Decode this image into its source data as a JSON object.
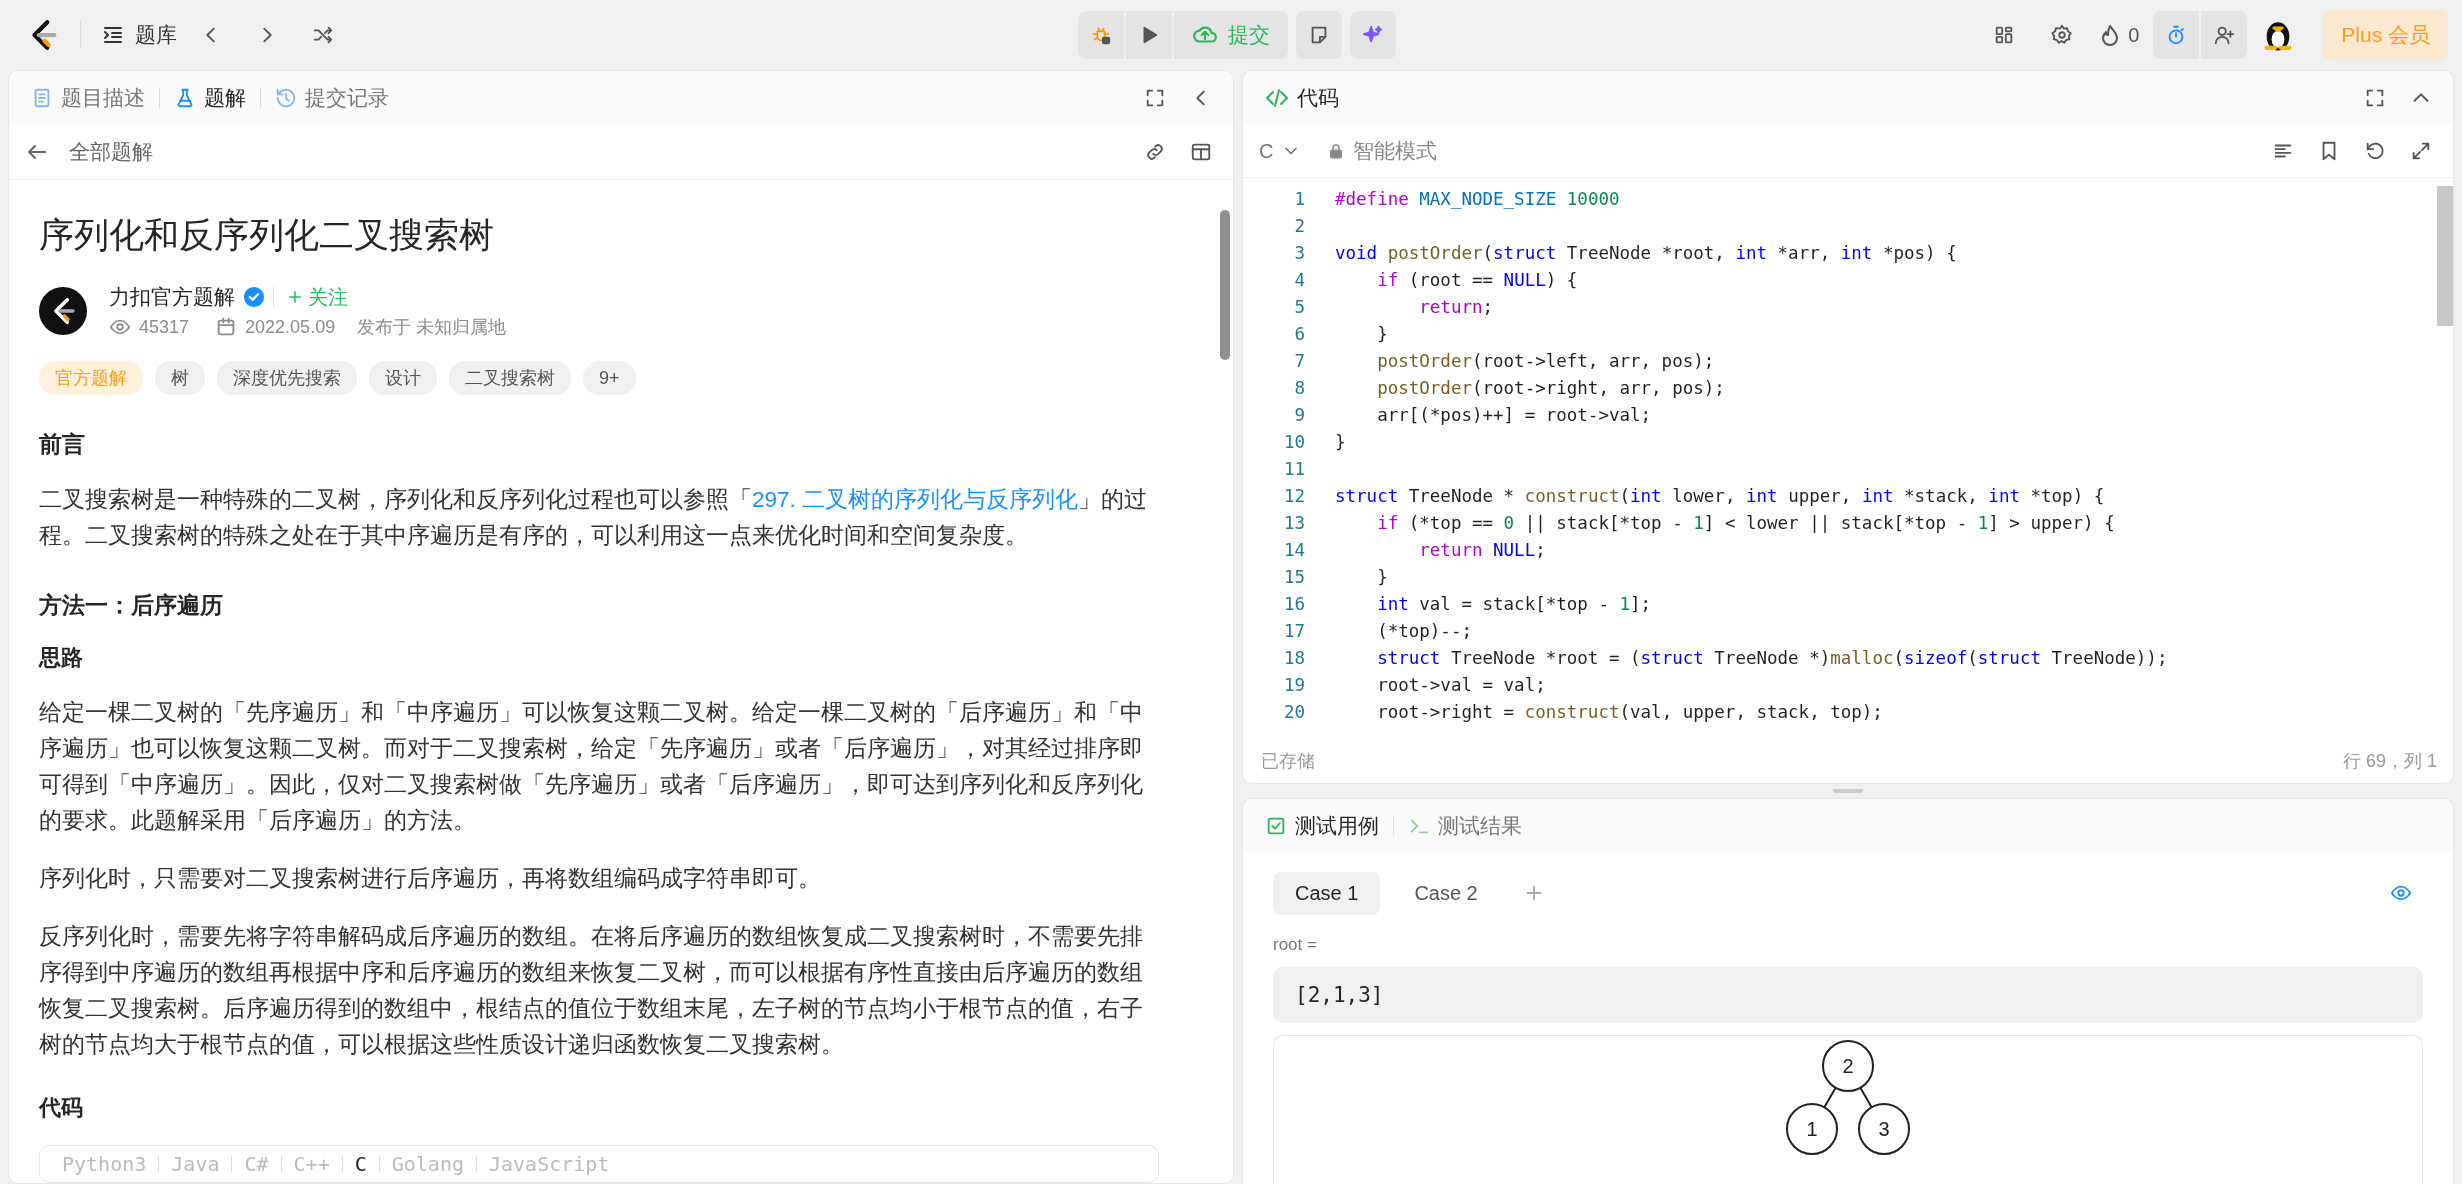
{
  "topbar": {
    "problem_list": "题库",
    "submit": "提交",
    "streak": "0",
    "plus": "Plus 会员"
  },
  "left_panel": {
    "tabs": [
      {
        "label": "题目描述",
        "selected": false
      },
      {
        "label": "题解",
        "selected": true
      },
      {
        "label": "提交记录",
        "selected": false
      }
    ],
    "back_link": "全部题解",
    "article": {
      "title": "序列化和反序列化二叉搜索树",
      "author": "力扣官方题解",
      "verified": true,
      "follow": "关注",
      "views": "45317",
      "date": "2022.05.09",
      "location": "发布于 未知归属地",
      "tags": [
        {
          "label": "官方题解",
          "kind": "official"
        },
        {
          "label": "树",
          "kind": "topic"
        },
        {
          "label": "深度优先搜索",
          "kind": "topic"
        },
        {
          "label": "设计",
          "kind": "topic"
        },
        {
          "label": "二叉搜索树",
          "kind": "topic"
        },
        {
          "label": "9+",
          "kind": "topic"
        }
      ],
      "blocks": [
        {
          "kind": "h2",
          "text": "前言"
        },
        {
          "kind": "p",
          "before": "二叉搜索树是一种特殊的二叉树，序列化和反序列化过程也可以参照「",
          "link": "297. 二叉树的序列化与反序列化",
          "after": "」的过程。二叉搜索树的特殊之处在于其中序遍历是有序的，可以利用这一点来优化时间和空间复杂度。"
        },
        {
          "kind": "h2",
          "text": "方法一：后序遍历"
        },
        {
          "kind": "h3",
          "text": "思路"
        },
        {
          "kind": "p",
          "before": "给定一棵二叉树的「先序遍历」和「中序遍历」可以恢复这颗二叉树。给定一棵二叉树的「后序遍历」和「中序遍历」也可以恢复这颗二叉树。而对于二叉搜索树，给定「先序遍历」或者「后序遍历」，对其经过排序即可得到「中序遍历」。因此，仅对二叉搜索树做「先序遍历」或者「后序遍历」，即可达到序列化和反序列化的要求。此题解采用「后序遍历」的方法。"
        },
        {
          "kind": "p",
          "before": "序列化时，只需要对二叉搜索树进行后序遍历，再将数组编码成字符串即可。"
        },
        {
          "kind": "p",
          "before": "反序列化时，需要先将字符串解码成后序遍历的数组。在将后序遍历的数组恢复成二叉搜索树时，不需要先排序得到中序遍历的数组再根据中序和后序遍历的数组来恢复二叉树，而可以根据有序性直接由后序遍历的数组恢复二叉搜索树。后序遍历得到的数组中，根结点的值位于数组末尾，左子树的节点均小于根节点的值，右子树的节点均大于根节点的值，可以根据这些性质设计递归函数恢复二叉搜索树。"
        },
        {
          "kind": "h3",
          "text": "代码"
        }
      ],
      "code_tabs": [
        {
          "label": "Python3",
          "selected": false
        },
        {
          "label": "Java",
          "selected": false
        },
        {
          "label": "C#",
          "selected": false
        },
        {
          "label": "C++",
          "selected": false
        },
        {
          "label": "C",
          "selected": true
        },
        {
          "label": "Golang",
          "selected": false
        },
        {
          "label": "JavaScript",
          "selected": false
        }
      ]
    }
  },
  "editor": {
    "title": "代码",
    "language": "C",
    "mode": "智能模式",
    "status": "已存储",
    "cursor": "行 69，列 1",
    "lines": [
      {
        "number": "1",
        "tokens": [
          {
            "kind": "keyword",
            "text": "#define "
          },
          {
            "kind": "macro",
            "text": "MAX_NODE_SIZE "
          },
          {
            "kind": "number",
            "text": "10000"
          }
        ]
      },
      {
        "number": "2"
      },
      {
        "number": "3",
        "tokens": [
          {
            "kind": "type",
            "text": "void "
          },
          {
            "kind": "function",
            "text": "postOrder"
          },
          {
            "kind": "plain",
            "text": "("
          },
          {
            "kind": "type",
            "text": "struct "
          },
          {
            "kind": "plain",
            "text": "TreeNode *root, "
          },
          {
            "kind": "type",
            "text": "int "
          },
          {
            "kind": "plain",
            "text": "*arr, "
          },
          {
            "kind": "type",
            "text": "int "
          },
          {
            "kind": "plain",
            "text": "*pos) {"
          }
        ]
      },
      {
        "number": "4",
        "tokens": [
          {
            "kind": "keyword",
            "text": "    if "
          },
          {
            "kind": "plain",
            "text": "(root == "
          },
          {
            "kind": "type",
            "text": "NULL"
          },
          {
            "kind": "plain",
            "text": ") {"
          }
        ]
      },
      {
        "number": "5",
        "tokens": [
          {
            "kind": "keyword",
            "text": "        return"
          },
          {
            "kind": "plain",
            "text": ";"
          }
        ]
      },
      {
        "number": "6",
        "tokens": [
          {
            "kind": "plain",
            "text": "    }"
          }
        ]
      },
      {
        "number": "7",
        "tokens": [
          {
            "kind": "function",
            "text": "    postOrder"
          },
          {
            "kind": "plain",
            "text": "(root->left, arr, pos);"
          }
        ]
      },
      {
        "number": "8",
        "tokens": [
          {
            "kind": "function",
            "text": "    postOrder"
          },
          {
            "kind": "plain",
            "text": "(root->right, arr, pos);"
          }
        ]
      },
      {
        "number": "9",
        "tokens": [
          {
            "kind": "plain",
            "text": "    arr[(*pos)++] = root->val;"
          }
        ]
      },
      {
        "number": "10",
        "tokens": [
          {
            "kind": "plain",
            "text": "}"
          }
        ]
      },
      {
        "number": "11"
      },
      {
        "number": "12",
        "tokens": [
          {
            "kind": "type",
            "text": "struct "
          },
          {
            "kind": "plain",
            "text": "TreeNode * "
          },
          {
            "kind": "function",
            "text": "construct"
          },
          {
            "kind": "plain",
            "text": "("
          },
          {
            "kind": "type",
            "text": "int "
          },
          {
            "kind": "plain",
            "text": "lower, "
          },
          {
            "kind": "type",
            "text": "int "
          },
          {
            "kind": "plain",
            "text": "upper, "
          },
          {
            "kind": "type",
            "text": "int "
          },
          {
            "kind": "plain",
            "text": "*stack, "
          },
          {
            "kind": "type",
            "text": "int "
          },
          {
            "kind": "plain",
            "text": "*top) {"
          }
        ]
      },
      {
        "number": "13",
        "tokens": [
          {
            "kind": "keyword",
            "text": "    if "
          },
          {
            "kind": "plain",
            "text": "(*top == "
          },
          {
            "kind": "number",
            "text": "0"
          },
          {
            "kind": "plain",
            "text": " || stack[*top - "
          },
          {
            "kind": "number",
            "text": "1"
          },
          {
            "kind": "plain",
            "text": "] < lower || stack[*top - "
          },
          {
            "kind": "number",
            "text": "1"
          },
          {
            "kind": "plain",
            "text": "] > upper) {"
          }
        ]
      },
      {
        "number": "14",
        "tokens": [
          {
            "kind": "keyword",
            "text": "        return "
          },
          {
            "kind": "type",
            "text": "NULL"
          },
          {
            "kind": "plain",
            "text": ";"
          }
        ]
      },
      {
        "number": "15",
        "tokens": [
          {
            "kind": "plain",
            "text": "    }"
          }
        ]
      },
      {
        "number": "16",
        "tokens": [
          {
            "kind": "type",
            "text": "    int "
          },
          {
            "kind": "plain",
            "text": "val = stack[*top - "
          },
          {
            "kind": "number",
            "text": "1"
          },
          {
            "kind": "plain",
            "text": "];"
          }
        ]
      },
      {
        "number": "17",
        "tokens": [
          {
            "kind": "plain",
            "text": "    (*top)--;"
          }
        ]
      },
      {
        "number": "18",
        "tokens": [
          {
            "kind": "type",
            "text": "    struct "
          },
          {
            "kind": "plain",
            "text": "TreeNode *root = ("
          },
          {
            "kind": "type",
            "text": "struct "
          },
          {
            "kind": "plain",
            "text": "TreeNode *)"
          },
          {
            "kind": "function",
            "text": "malloc"
          },
          {
            "kind": "plain",
            "text": "("
          },
          {
            "kind": "type",
            "text": "sizeof"
          },
          {
            "kind": "plain",
            "text": "("
          },
          {
            "kind": "type",
            "text": "struct "
          },
          {
            "kind": "plain",
            "text": "TreeNode));"
          }
        ]
      },
      {
        "number": "19",
        "tokens": [
          {
            "kind": "plain",
            "text": "    root->val = val;"
          }
        ]
      },
      {
        "number": "20",
        "tokens": [
          {
            "kind": "plain",
            "text": "    root->right = "
          },
          {
            "kind": "function",
            "text": "construct"
          },
          {
            "kind": "plain",
            "text": "(val, upper, stack, top);"
          }
        ]
      }
    ]
  },
  "tests": {
    "tabs": [
      {
        "label": "测试用例",
        "selected": true
      },
      {
        "label": "测试结果",
        "selected": false
      }
    ],
    "cases": [
      {
        "label": "Case 1",
        "selected": true
      },
      {
        "label": "Case 2",
        "selected": false
      }
    ],
    "param": "root =",
    "value": "[2,1,3]",
    "tree": {
      "value": "2",
      "children": [
        {
          "value": "1"
        },
        {
          "value": "3"
        }
      ]
    }
  }
}
